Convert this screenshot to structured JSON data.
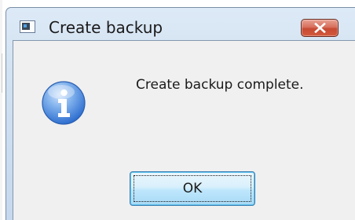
{
  "dialog": {
    "title": "Create backup",
    "message": "Create backup complete.",
    "ok_label": "OK",
    "icons": {
      "app": "application-window-icon",
      "close": "close-icon",
      "message": "information-icon"
    },
    "colors": {
      "title_bar": "#cfe0f1",
      "close_button": "#c64a32",
      "client_background": "#f0f0f0",
      "info_icon": "#2f6fd0",
      "ok_button": "#bee6fd"
    }
  }
}
